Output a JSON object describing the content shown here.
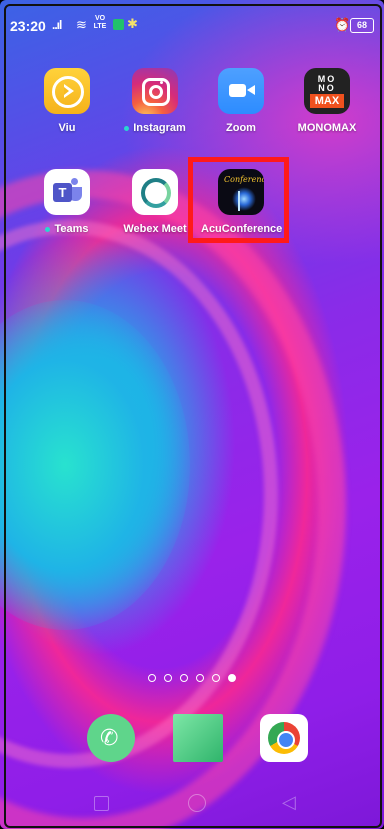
{
  "status_bar": {
    "time": "23:20",
    "signal": "..ıl",
    "wifi": "≋",
    "volte": "VO LTE",
    "battery": "68"
  },
  "apps": [
    {
      "label": "Viu",
      "icon": "viu-icon"
    },
    {
      "label": "Instagram",
      "icon": "instagram-icon",
      "notification_dot": true
    },
    {
      "label": "Zoom",
      "icon": "zoom-icon"
    },
    {
      "label": "MONOMAX",
      "icon": "monomax-icon"
    },
    {
      "label": "Teams",
      "icon": "teams-icon",
      "notification_dot": true
    },
    {
      "label": "Webex Meet",
      "icon": "webex-icon"
    },
    {
      "label": "AcuConference",
      "icon": "acuconference-icon",
      "highlighted": true
    }
  ],
  "monomax_logo": {
    "line1": "MO",
    "line2": "NO",
    "line3": "MAX"
  },
  "acuconference_logo": {
    "text": "Conference"
  },
  "page_indicator": {
    "total": 6,
    "active": 6
  },
  "dock": [
    "phone-icon",
    "messages-icon",
    "chrome-icon"
  ],
  "highlight_color": "#ff1a1a"
}
